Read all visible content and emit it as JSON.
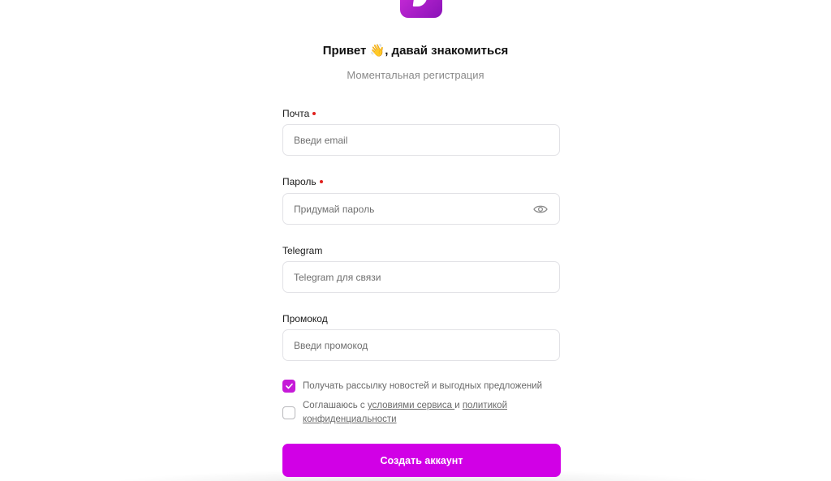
{
  "header": {
    "title": "Привет 👋, давай знакомиться",
    "subtitle": "Моментальная регистрация"
  },
  "form": {
    "email": {
      "label": "Почта",
      "required": true,
      "placeholder": "Введи email",
      "value": ""
    },
    "password": {
      "label": "Пароль",
      "required": true,
      "placeholder": "Придумай пароль",
      "value": "",
      "icon": "eye-icon"
    },
    "telegram": {
      "label": "Telegram",
      "required": false,
      "placeholder": "Telegram для связи",
      "value": ""
    },
    "promo": {
      "label": "Промокод",
      "required": false,
      "placeholder": "Введи промокод",
      "value": ""
    },
    "newsletter": {
      "checked": true,
      "label": "Получать рассылку новостей и выгодных предложений"
    },
    "terms": {
      "checked": false,
      "prefix": "Соглашаюсь с ",
      "link_terms": "условиями сервиса ",
      "middle": "и ",
      "link_privacy_1": "политикой",
      "link_privacy_2": "конфиденциальности"
    },
    "submit_label": "Создать аккаунт"
  },
  "colors": {
    "accent": "#d100e6",
    "checkbox_accent": "#c61ad8",
    "required_dot": "#e0201d",
    "logo": "#a51bc7"
  }
}
